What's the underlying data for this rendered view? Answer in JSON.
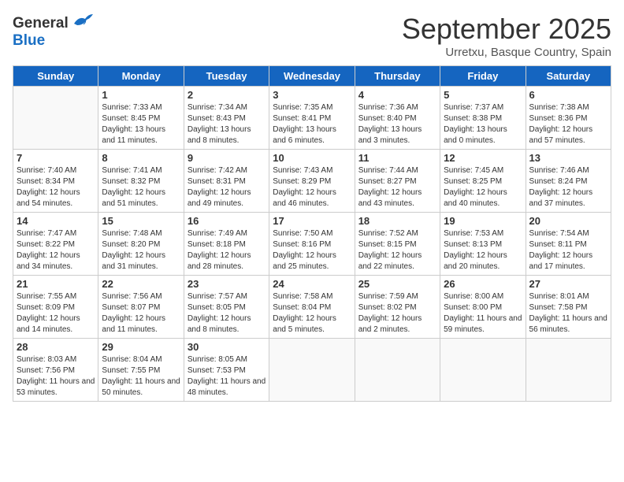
{
  "header": {
    "logo_general": "General",
    "logo_blue": "Blue",
    "month_title": "September 2025",
    "subtitle": "Urretxu, Basque Country, Spain"
  },
  "weekdays": [
    "Sunday",
    "Monday",
    "Tuesday",
    "Wednesday",
    "Thursday",
    "Friday",
    "Saturday"
  ],
  "weeks": [
    [
      {
        "day": "",
        "sunrise": "",
        "sunset": "",
        "daylight": ""
      },
      {
        "day": "1",
        "sunrise": "Sunrise: 7:33 AM",
        "sunset": "Sunset: 8:45 PM",
        "daylight": "Daylight: 13 hours and 11 minutes."
      },
      {
        "day": "2",
        "sunrise": "Sunrise: 7:34 AM",
        "sunset": "Sunset: 8:43 PM",
        "daylight": "Daylight: 13 hours and 8 minutes."
      },
      {
        "day": "3",
        "sunrise": "Sunrise: 7:35 AM",
        "sunset": "Sunset: 8:41 PM",
        "daylight": "Daylight: 13 hours and 6 minutes."
      },
      {
        "day": "4",
        "sunrise": "Sunrise: 7:36 AM",
        "sunset": "Sunset: 8:40 PM",
        "daylight": "Daylight: 13 hours and 3 minutes."
      },
      {
        "day": "5",
        "sunrise": "Sunrise: 7:37 AM",
        "sunset": "Sunset: 8:38 PM",
        "daylight": "Daylight: 13 hours and 0 minutes."
      },
      {
        "day": "6",
        "sunrise": "Sunrise: 7:38 AM",
        "sunset": "Sunset: 8:36 PM",
        "daylight": "Daylight: 12 hours and 57 minutes."
      }
    ],
    [
      {
        "day": "7",
        "sunrise": "Sunrise: 7:40 AM",
        "sunset": "Sunset: 8:34 PM",
        "daylight": "Daylight: 12 hours and 54 minutes."
      },
      {
        "day": "8",
        "sunrise": "Sunrise: 7:41 AM",
        "sunset": "Sunset: 8:32 PM",
        "daylight": "Daylight: 12 hours and 51 minutes."
      },
      {
        "day": "9",
        "sunrise": "Sunrise: 7:42 AM",
        "sunset": "Sunset: 8:31 PM",
        "daylight": "Daylight: 12 hours and 49 minutes."
      },
      {
        "day": "10",
        "sunrise": "Sunrise: 7:43 AM",
        "sunset": "Sunset: 8:29 PM",
        "daylight": "Daylight: 12 hours and 46 minutes."
      },
      {
        "day": "11",
        "sunrise": "Sunrise: 7:44 AM",
        "sunset": "Sunset: 8:27 PM",
        "daylight": "Daylight: 12 hours and 43 minutes."
      },
      {
        "day": "12",
        "sunrise": "Sunrise: 7:45 AM",
        "sunset": "Sunset: 8:25 PM",
        "daylight": "Daylight: 12 hours and 40 minutes."
      },
      {
        "day": "13",
        "sunrise": "Sunrise: 7:46 AM",
        "sunset": "Sunset: 8:24 PM",
        "daylight": "Daylight: 12 hours and 37 minutes."
      }
    ],
    [
      {
        "day": "14",
        "sunrise": "Sunrise: 7:47 AM",
        "sunset": "Sunset: 8:22 PM",
        "daylight": "Daylight: 12 hours and 34 minutes."
      },
      {
        "day": "15",
        "sunrise": "Sunrise: 7:48 AM",
        "sunset": "Sunset: 8:20 PM",
        "daylight": "Daylight: 12 hours and 31 minutes."
      },
      {
        "day": "16",
        "sunrise": "Sunrise: 7:49 AM",
        "sunset": "Sunset: 8:18 PM",
        "daylight": "Daylight: 12 hours and 28 minutes."
      },
      {
        "day": "17",
        "sunrise": "Sunrise: 7:50 AM",
        "sunset": "Sunset: 8:16 PM",
        "daylight": "Daylight: 12 hours and 25 minutes."
      },
      {
        "day": "18",
        "sunrise": "Sunrise: 7:52 AM",
        "sunset": "Sunset: 8:15 PM",
        "daylight": "Daylight: 12 hours and 22 minutes."
      },
      {
        "day": "19",
        "sunrise": "Sunrise: 7:53 AM",
        "sunset": "Sunset: 8:13 PM",
        "daylight": "Daylight: 12 hours and 20 minutes."
      },
      {
        "day": "20",
        "sunrise": "Sunrise: 7:54 AM",
        "sunset": "Sunset: 8:11 PM",
        "daylight": "Daylight: 12 hours and 17 minutes."
      }
    ],
    [
      {
        "day": "21",
        "sunrise": "Sunrise: 7:55 AM",
        "sunset": "Sunset: 8:09 PM",
        "daylight": "Daylight: 12 hours and 14 minutes."
      },
      {
        "day": "22",
        "sunrise": "Sunrise: 7:56 AM",
        "sunset": "Sunset: 8:07 PM",
        "daylight": "Daylight: 12 hours and 11 minutes."
      },
      {
        "day": "23",
        "sunrise": "Sunrise: 7:57 AM",
        "sunset": "Sunset: 8:05 PM",
        "daylight": "Daylight: 12 hours and 8 minutes."
      },
      {
        "day": "24",
        "sunrise": "Sunrise: 7:58 AM",
        "sunset": "Sunset: 8:04 PM",
        "daylight": "Daylight: 12 hours and 5 minutes."
      },
      {
        "day": "25",
        "sunrise": "Sunrise: 7:59 AM",
        "sunset": "Sunset: 8:02 PM",
        "daylight": "Daylight: 12 hours and 2 minutes."
      },
      {
        "day": "26",
        "sunrise": "Sunrise: 8:00 AM",
        "sunset": "Sunset: 8:00 PM",
        "daylight": "Daylight: 11 hours and 59 minutes."
      },
      {
        "day": "27",
        "sunrise": "Sunrise: 8:01 AM",
        "sunset": "Sunset: 7:58 PM",
        "daylight": "Daylight: 11 hours and 56 minutes."
      }
    ],
    [
      {
        "day": "28",
        "sunrise": "Sunrise: 8:03 AM",
        "sunset": "Sunset: 7:56 PM",
        "daylight": "Daylight: 11 hours and 53 minutes."
      },
      {
        "day": "29",
        "sunrise": "Sunrise: 8:04 AM",
        "sunset": "Sunset: 7:55 PM",
        "daylight": "Daylight: 11 hours and 50 minutes."
      },
      {
        "day": "30",
        "sunrise": "Sunrise: 8:05 AM",
        "sunset": "Sunset: 7:53 PM",
        "daylight": "Daylight: 11 hours and 48 minutes."
      },
      {
        "day": "",
        "sunrise": "",
        "sunset": "",
        "daylight": ""
      },
      {
        "day": "",
        "sunrise": "",
        "sunset": "",
        "daylight": ""
      },
      {
        "day": "",
        "sunrise": "",
        "sunset": "",
        "daylight": ""
      },
      {
        "day": "",
        "sunrise": "",
        "sunset": "",
        "daylight": ""
      }
    ]
  ]
}
